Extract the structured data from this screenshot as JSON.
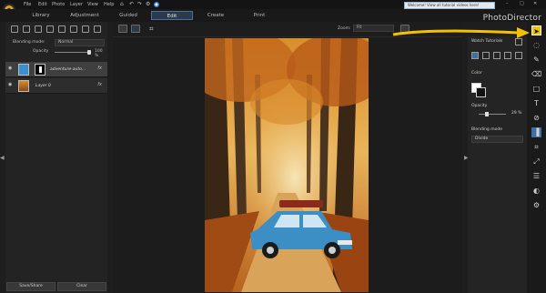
{
  "app": {
    "name": "PhotoDirector"
  },
  "menu": [
    "File",
    "Edit",
    "Photo",
    "Layer",
    "View",
    "Help"
  ],
  "notice": {
    "text": "Welcome! View all tutorial videos here!"
  },
  "window": {
    "min": "–",
    "max": "□",
    "close": "✕"
  },
  "tabs": [
    {
      "label": "Library",
      "active": false
    },
    {
      "label": "Adjustment",
      "active": false
    },
    {
      "label": "Guided",
      "active": false
    },
    {
      "label": "Edit",
      "active": true
    },
    {
      "label": "Create",
      "active": false
    },
    {
      "label": "Print",
      "active": false
    }
  ],
  "left_panel": {
    "blending_label": "Blending mode:",
    "blending_value": "Normal",
    "opacity_label": "Opacity",
    "opacity_value": "100 %",
    "opacity_fraction": 1.0,
    "layers": [
      {
        "name": "adventure-auto...",
        "selected": true,
        "fx": "fx"
      },
      {
        "name": "Layer 0",
        "selected": false,
        "fx": "fx"
      }
    ],
    "buttons": {
      "save": "Save/Share",
      "clear": "Clear"
    }
  },
  "canvas_toolbar": {
    "zoom_label": "Zoom:",
    "zoom_value": "Fit"
  },
  "right_panel": {
    "tutorials": "Watch Tutorials",
    "color_label": "Color",
    "opacity_label": "Opacity",
    "opacity_value": "29 %",
    "opacity_fraction": 0.29,
    "blend_label": "Blending mode",
    "blend_value": "Divide"
  },
  "colors": {
    "accent": "#f2c200",
    "active_tab": "#2b3a4d"
  }
}
